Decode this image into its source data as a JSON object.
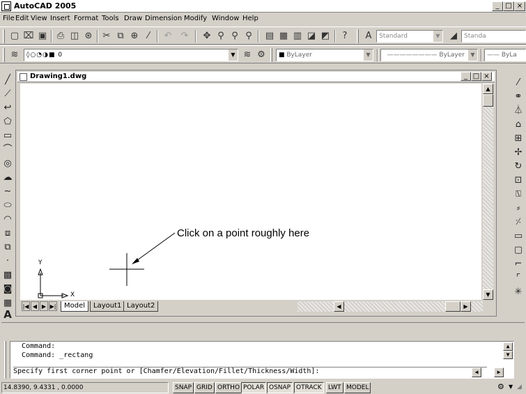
{
  "app": {
    "title": "AutoCAD 2005",
    "window_controls": [
      "_",
      "□",
      "×"
    ]
  },
  "menu": [
    "File",
    "Edit",
    "View",
    "Insert",
    "Format",
    "Tools",
    "Draw",
    "Dimension",
    "Modify",
    "Window",
    "Help"
  ],
  "standard_toolbar": {
    "text_style_combo": "Standard",
    "dim_style_combo": "Standa"
  },
  "layers_toolbar": {
    "layer_combo": "0",
    "color_combo": "ByLayer",
    "linetype_combo": "ByLayer",
    "lineweight_combo": "ByLa"
  },
  "drawing": {
    "title": "Drawing1.dwg",
    "tabs": [
      "Model",
      "Layout1",
      "Layout2"
    ],
    "active_tab": "Model",
    "ucs": {
      "y_label": "Y",
      "x_label": "X"
    }
  },
  "annotation": {
    "text": "Click on a point roughly here"
  },
  "command_history": [
    "Command:",
    "Command:  _rectang",
    "Specify first corner point or [Chamfer/Elevation/Fillet/Thickness/Width]:"
  ],
  "status": {
    "coordinates": "14.8390, 9.4331 , 0.0000",
    "buttons": [
      {
        "label": "SNAP",
        "on": false
      },
      {
        "label": "GRID",
        "on": false
      },
      {
        "label": "ORTHO",
        "on": false
      },
      {
        "label": "POLAR",
        "on": true
      },
      {
        "label": "OSNAP",
        "on": true
      },
      {
        "label": "OTRACK",
        "on": true
      },
      {
        "label": "LWT",
        "on": false
      },
      {
        "label": "MODEL",
        "on": false
      }
    ]
  },
  "icons": {
    "draw_palette": [
      "line-icon",
      "construction-line-icon",
      "polyline-icon",
      "polygon-icon",
      "rectangle-icon",
      "arc-icon",
      "circle-icon",
      "revision-cloud-icon",
      "spline-icon",
      "ellipse-icon",
      "ellipse-arc-icon",
      "insert-block-icon",
      "make-block-icon",
      "point-icon",
      "hatch-icon",
      "region-icon",
      "table-icon",
      "multiline-text-icon"
    ],
    "modify_palette": [
      "erase-icon",
      "copy-icon",
      "mirror-icon",
      "offset-icon",
      "array-icon",
      "move-icon",
      "rotate-icon",
      "scale-icon",
      "stretch-icon",
      "trim-icon",
      "extend-icon",
      "break-at-point-icon",
      "break-icon",
      "chamfer-icon",
      "fillet-icon",
      "explode-icon"
    ]
  }
}
